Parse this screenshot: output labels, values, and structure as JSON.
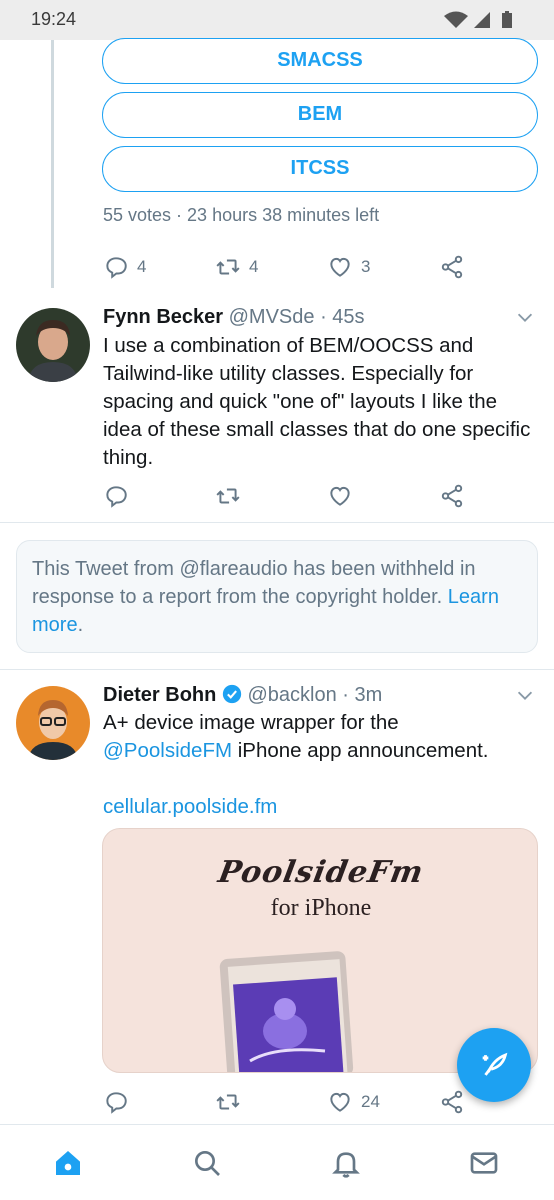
{
  "status_bar": {
    "time": "19:24"
  },
  "poll": {
    "options": [
      "SMACSS",
      "BEM",
      "ITCSS"
    ],
    "meta": "55 votes · 23 hours 38 minutes left",
    "actions": {
      "reply_count": "4",
      "retweet_count": "4",
      "like_count": "3"
    }
  },
  "tweet1": {
    "name": "Fynn Becker",
    "handle": "@MVSde",
    "time": "· 45s",
    "text": "I use a combination of BEM/OOCSS and Tailwind-like utility classes. Especially for spacing and quick \"one of\" layouts I like the idea of these small classes that do one specific thing."
  },
  "withheld": {
    "text": "This Tweet from @flareaudio has been withheld in response to a report from the copyright holder.",
    "link": "Learn more",
    "suffix": "."
  },
  "tweet2": {
    "name": "Dieter Bohn",
    "handle": "@backlon",
    "time": "· 3m",
    "text_before": "A+ device image wrapper for the",
    "mention": "@PoolsideFM",
    "text_after": " iPhone app announcement.",
    "url": "cellular.poolside.fm",
    "card": {
      "logo": "PoolsideFm",
      "subtitle": "for iPhone"
    },
    "actions": {
      "like_count": "24"
    }
  },
  "colors": {
    "accent": "#1da1f2",
    "muted": "#657786",
    "link": "#1b95e0"
  },
  "icons": {
    "nav": [
      "home-icon",
      "search-icon",
      "bell-icon",
      "mail-icon"
    ],
    "actions": [
      "reply-icon",
      "retweet-icon",
      "like-icon",
      "share-icon"
    ]
  }
}
